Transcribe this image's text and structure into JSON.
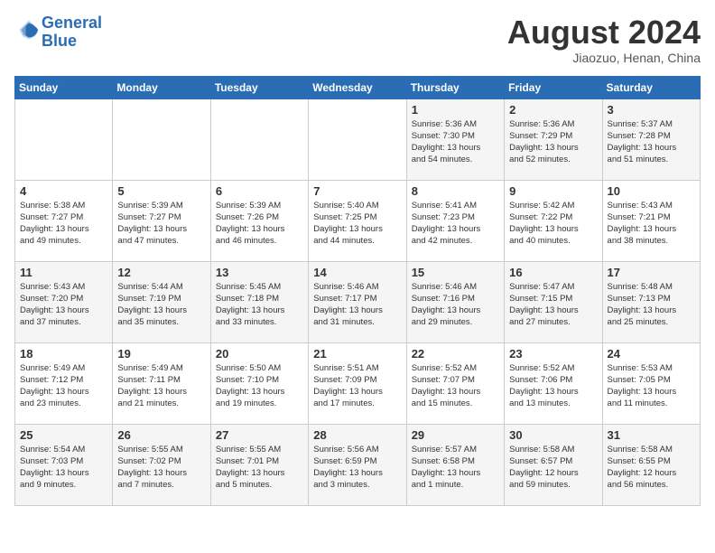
{
  "header": {
    "logo_line1": "General",
    "logo_line2": "Blue",
    "month_title": "August 2024",
    "location": "Jiaozuo, Henan, China"
  },
  "days_of_week": [
    "Sunday",
    "Monday",
    "Tuesday",
    "Wednesday",
    "Thursday",
    "Friday",
    "Saturday"
  ],
  "weeks": [
    [
      {
        "day": "",
        "content": ""
      },
      {
        "day": "",
        "content": ""
      },
      {
        "day": "",
        "content": ""
      },
      {
        "day": "",
        "content": ""
      },
      {
        "day": "1",
        "content": "Sunrise: 5:36 AM\nSunset: 7:30 PM\nDaylight: 13 hours\nand 54 minutes."
      },
      {
        "day": "2",
        "content": "Sunrise: 5:36 AM\nSunset: 7:29 PM\nDaylight: 13 hours\nand 52 minutes."
      },
      {
        "day": "3",
        "content": "Sunrise: 5:37 AM\nSunset: 7:28 PM\nDaylight: 13 hours\nand 51 minutes."
      }
    ],
    [
      {
        "day": "4",
        "content": "Sunrise: 5:38 AM\nSunset: 7:27 PM\nDaylight: 13 hours\nand 49 minutes."
      },
      {
        "day": "5",
        "content": "Sunrise: 5:39 AM\nSunset: 7:27 PM\nDaylight: 13 hours\nand 47 minutes."
      },
      {
        "day": "6",
        "content": "Sunrise: 5:39 AM\nSunset: 7:26 PM\nDaylight: 13 hours\nand 46 minutes."
      },
      {
        "day": "7",
        "content": "Sunrise: 5:40 AM\nSunset: 7:25 PM\nDaylight: 13 hours\nand 44 minutes."
      },
      {
        "day": "8",
        "content": "Sunrise: 5:41 AM\nSunset: 7:23 PM\nDaylight: 13 hours\nand 42 minutes."
      },
      {
        "day": "9",
        "content": "Sunrise: 5:42 AM\nSunset: 7:22 PM\nDaylight: 13 hours\nand 40 minutes."
      },
      {
        "day": "10",
        "content": "Sunrise: 5:43 AM\nSunset: 7:21 PM\nDaylight: 13 hours\nand 38 minutes."
      }
    ],
    [
      {
        "day": "11",
        "content": "Sunrise: 5:43 AM\nSunset: 7:20 PM\nDaylight: 13 hours\nand 37 minutes."
      },
      {
        "day": "12",
        "content": "Sunrise: 5:44 AM\nSunset: 7:19 PM\nDaylight: 13 hours\nand 35 minutes."
      },
      {
        "day": "13",
        "content": "Sunrise: 5:45 AM\nSunset: 7:18 PM\nDaylight: 13 hours\nand 33 minutes."
      },
      {
        "day": "14",
        "content": "Sunrise: 5:46 AM\nSunset: 7:17 PM\nDaylight: 13 hours\nand 31 minutes."
      },
      {
        "day": "15",
        "content": "Sunrise: 5:46 AM\nSunset: 7:16 PM\nDaylight: 13 hours\nand 29 minutes."
      },
      {
        "day": "16",
        "content": "Sunrise: 5:47 AM\nSunset: 7:15 PM\nDaylight: 13 hours\nand 27 minutes."
      },
      {
        "day": "17",
        "content": "Sunrise: 5:48 AM\nSunset: 7:13 PM\nDaylight: 13 hours\nand 25 minutes."
      }
    ],
    [
      {
        "day": "18",
        "content": "Sunrise: 5:49 AM\nSunset: 7:12 PM\nDaylight: 13 hours\nand 23 minutes."
      },
      {
        "day": "19",
        "content": "Sunrise: 5:49 AM\nSunset: 7:11 PM\nDaylight: 13 hours\nand 21 minutes."
      },
      {
        "day": "20",
        "content": "Sunrise: 5:50 AM\nSunset: 7:10 PM\nDaylight: 13 hours\nand 19 minutes."
      },
      {
        "day": "21",
        "content": "Sunrise: 5:51 AM\nSunset: 7:09 PM\nDaylight: 13 hours\nand 17 minutes."
      },
      {
        "day": "22",
        "content": "Sunrise: 5:52 AM\nSunset: 7:07 PM\nDaylight: 13 hours\nand 15 minutes."
      },
      {
        "day": "23",
        "content": "Sunrise: 5:52 AM\nSunset: 7:06 PM\nDaylight: 13 hours\nand 13 minutes."
      },
      {
        "day": "24",
        "content": "Sunrise: 5:53 AM\nSunset: 7:05 PM\nDaylight: 13 hours\nand 11 minutes."
      }
    ],
    [
      {
        "day": "25",
        "content": "Sunrise: 5:54 AM\nSunset: 7:03 PM\nDaylight: 13 hours\nand 9 minutes."
      },
      {
        "day": "26",
        "content": "Sunrise: 5:55 AM\nSunset: 7:02 PM\nDaylight: 13 hours\nand 7 minutes."
      },
      {
        "day": "27",
        "content": "Sunrise: 5:55 AM\nSunset: 7:01 PM\nDaylight: 13 hours\nand 5 minutes."
      },
      {
        "day": "28",
        "content": "Sunrise: 5:56 AM\nSunset: 6:59 PM\nDaylight: 13 hours\nand 3 minutes."
      },
      {
        "day": "29",
        "content": "Sunrise: 5:57 AM\nSunset: 6:58 PM\nDaylight: 13 hours\nand 1 minute."
      },
      {
        "day": "30",
        "content": "Sunrise: 5:58 AM\nSunset: 6:57 PM\nDaylight: 12 hours\nand 59 minutes."
      },
      {
        "day": "31",
        "content": "Sunrise: 5:58 AM\nSunset: 6:55 PM\nDaylight: 12 hours\nand 56 minutes."
      }
    ]
  ]
}
